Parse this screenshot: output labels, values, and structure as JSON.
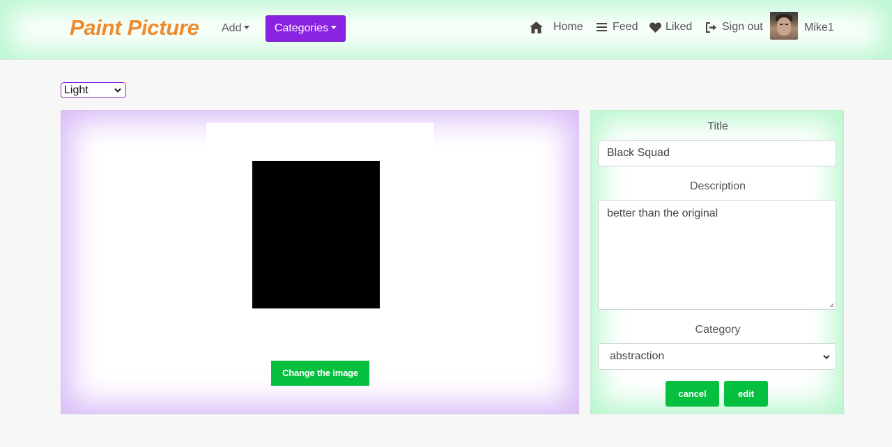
{
  "header": {
    "brand": "Paint Picture",
    "add_label": "Add",
    "categories_label": "Categories",
    "links": {
      "home": "Home",
      "feed": "Feed",
      "liked": "Liked",
      "signout": "Sign out"
    },
    "username": "Mike1"
  },
  "theme": {
    "selected": "Light"
  },
  "image_panel": {
    "change_button": "Change the image"
  },
  "form": {
    "title_label": "Title",
    "title_value": "Black Squad",
    "description_label": "Description",
    "description_value": "better than the original",
    "category_label": "Category",
    "category_value": "abstraction",
    "cancel_label": "cancel",
    "edit_label": "edit"
  },
  "colors": {
    "brand": "#ef8a2d",
    "categories_button": "#8a22e2",
    "action_green": "#05bf3f",
    "header_glow": "#b9f7cf",
    "image_panel_glow": "#d8bbf7"
  },
  "icons": [
    "home-icon",
    "feed-icon",
    "heart-icon",
    "sign-out-icon",
    "chevron-down-icon"
  ]
}
